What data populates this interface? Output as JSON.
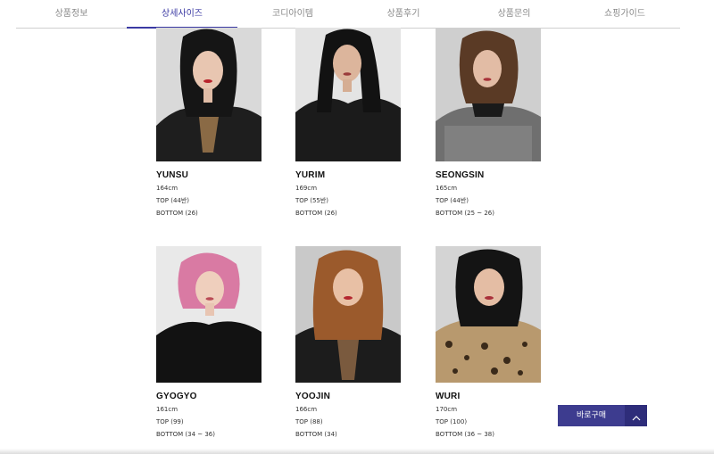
{
  "tabs": [
    {
      "label": "상품정보"
    },
    {
      "label": "상세사이즈"
    },
    {
      "label": "코디아이템"
    },
    {
      "label": "상품후기"
    },
    {
      "label": "상품문의"
    },
    {
      "label": "쇼핑가이드"
    }
  ],
  "models": [
    {
      "name": "YUNSU",
      "height": "164cm",
      "top": "TOP (44반)",
      "bottom": "BOTTOM (26)"
    },
    {
      "name": "YURIM",
      "height": "169cm",
      "top": "TOP (55반)",
      "bottom": "BOTTOM (26)"
    },
    {
      "name": "SEONGSIN",
      "height": "165cm",
      "top": "TOP (44반)",
      "bottom": "BOTTOM (25 ~ 26)"
    },
    {
      "name": "GYOGYO",
      "height": "161cm",
      "top": "TOP (99)",
      "bottom": "BOTTOM (34 ~ 36)"
    },
    {
      "name": "YOOJIN",
      "height": "166cm",
      "top": "TOP (88)",
      "bottom": "BOTTOM (34)"
    },
    {
      "name": "WURI",
      "height": "170cm",
      "top": "TOP (100)",
      "bottom": "BOTTOM (36 ~ 38)"
    }
  ],
  "buy_bar": {
    "buy_label": "바로구매"
  },
  "colors": {
    "accent": "#3b3aa3",
    "buy_bg": "#3d3c8f"
  }
}
